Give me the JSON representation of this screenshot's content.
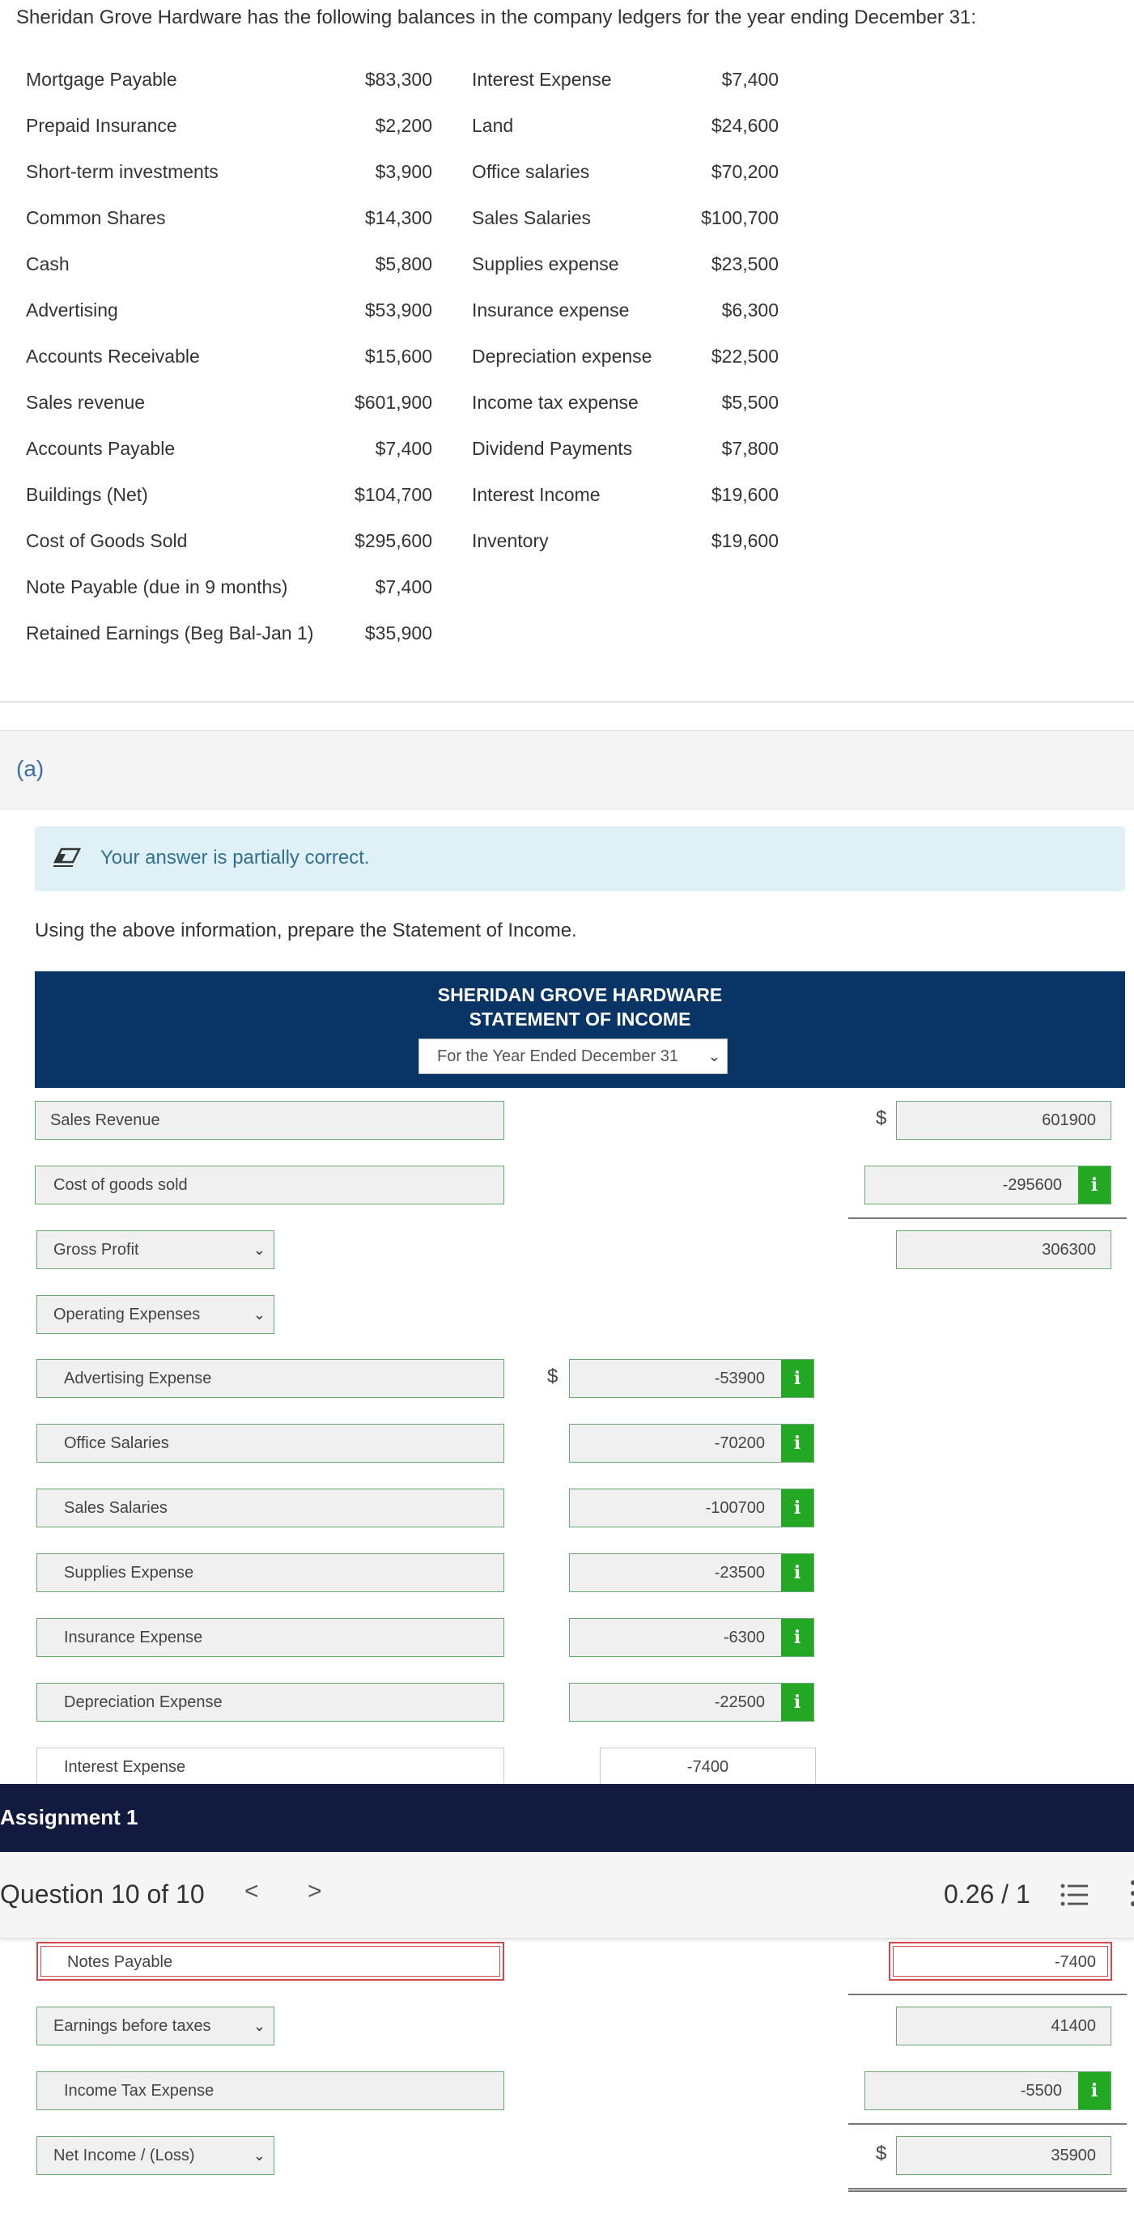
{
  "problem": {
    "intro": "Sheridan Grove Hardware has the following balances in the company ledgers for the year ending December 31:",
    "balances_left": [
      {
        "label": "Mortgage Payable",
        "amount": "$83,300"
      },
      {
        "label": "Prepaid Insurance",
        "amount": "$2,200"
      },
      {
        "label": "Short-term investments",
        "amount": "$3,900"
      },
      {
        "label": "Common Shares",
        "amount": "$14,300"
      },
      {
        "label": "Cash",
        "amount": "$5,800"
      },
      {
        "label": "Advertising",
        "amount": "$53,900"
      },
      {
        "label": "Accounts Receivable",
        "amount": "$15,600"
      },
      {
        "label": "Sales revenue",
        "amount": "$601,900"
      },
      {
        "label": "Accounts Payable",
        "amount": "$7,400"
      },
      {
        "label": "Buildings (Net)",
        "amount": "$104,700"
      },
      {
        "label": "Cost of Goods Sold",
        "amount": "$295,600"
      },
      {
        "label": "Note Payable (due in 9 months)",
        "amount": "$7,400"
      },
      {
        "label": "Retained Earnings (Beg Bal-Jan 1)",
        "amount": "$35,900"
      }
    ],
    "balances_right": [
      {
        "label": "Interest Expense",
        "amount": "$7,400"
      },
      {
        "label": "Land",
        "amount": "$24,600"
      },
      {
        "label": "Office salaries",
        "amount": "$70,200"
      },
      {
        "label": "Sales Salaries",
        "amount": "$100,700"
      },
      {
        "label": "Supplies expense",
        "amount": "$23,500"
      },
      {
        "label": "Insurance expense",
        "amount": "$6,300"
      },
      {
        "label": "Depreciation expense",
        "amount": "$22,500"
      },
      {
        "label": "Income tax expense",
        "amount": "$5,500"
      },
      {
        "label": "Dividend Payments",
        "amount": "$7,800"
      },
      {
        "label": "Interest Income",
        "amount": "$19,600"
      },
      {
        "label": "Inventory",
        "amount": "$19,600"
      }
    ]
  },
  "part": {
    "label": "(a)"
  },
  "feedback": {
    "text": "Your answer is partially correct.",
    "icon": "eraser-icon"
  },
  "instruction": "Using the above information, prepare the Statement of Income.",
  "statement": {
    "company": "SHERIDAN GROVE HARDWARE",
    "title": "STATEMENT OF INCOME",
    "period": "For the Year Ended December 31",
    "rows": {
      "sales_revenue": {
        "label": "Sales Revenue",
        "currency": "$",
        "value": "601900"
      },
      "cogs": {
        "label": "Cost of goods sold",
        "value": "-295600"
      },
      "gross_profit": {
        "label": "Gross Profit",
        "value": "306300"
      },
      "operating_expenses": {
        "label": "Operating Expenses"
      },
      "advertising": {
        "label": "Advertising Expense",
        "currency": "$",
        "value": "-53900"
      },
      "office_salaries": {
        "label": "Office Salaries",
        "value": "-70200"
      },
      "sales_salaries": {
        "label": "Sales Salaries",
        "value": "-100700"
      },
      "supplies": {
        "label": "Supplies Expense",
        "value": "-23500"
      },
      "insurance": {
        "label": "Insurance Expense",
        "value": "-6300"
      },
      "depreciation": {
        "label": "Depreciation Expense",
        "value": "-22500"
      },
      "interest_expense": {
        "label": "Interest Expense",
        "value": "-7400"
      },
      "notes_payable": {
        "label": "Notes Payable",
        "value": "-7400"
      },
      "earnings_before_taxes": {
        "label": "Earnings before taxes",
        "value": "41400"
      },
      "income_tax": {
        "label": "Income Tax Expense",
        "value": "-5500"
      },
      "net_income": {
        "label": "Net Income / (Loss)",
        "currency": "$",
        "value": "35900"
      }
    },
    "info_glyph": "i"
  },
  "assignment": {
    "title": "Assignment 1"
  },
  "question_nav": {
    "question": "Question 10 of 10",
    "prev": "<",
    "next": ">",
    "score": "0.26 / 1"
  },
  "colors": {
    "header_navy": "#083466",
    "assignment_bar": "#121b3f",
    "correct_green": "#22a822",
    "incorrect_red": "#d14949",
    "feedback_bg": "#dff0f7"
  }
}
